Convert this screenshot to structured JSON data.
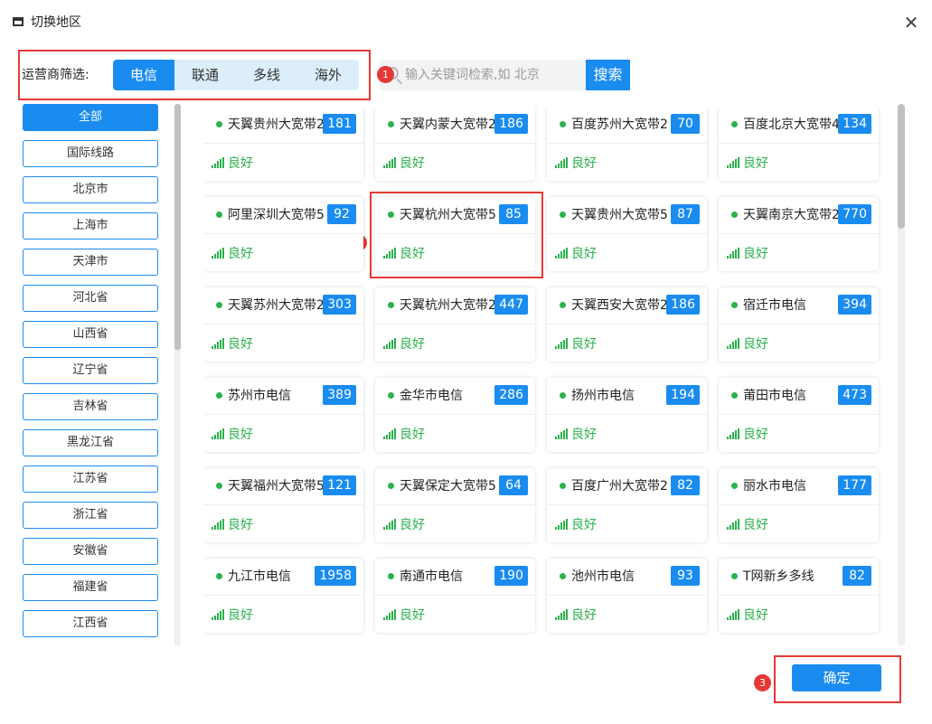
{
  "window": {
    "title": "切换地区",
    "close_symbol": "✕"
  },
  "filter": {
    "label": "运营商筛选:",
    "isps": [
      {
        "label": "电信",
        "active": true
      },
      {
        "label": "联通",
        "active": false
      },
      {
        "label": "多线",
        "active": false
      },
      {
        "label": "海外",
        "active": false
      }
    ]
  },
  "search": {
    "placeholder": "输入关键词检索,如 北京",
    "button_label": "搜索"
  },
  "annotations": {
    "badge1": "1",
    "badge2": "2",
    "badge3": "3",
    "color": "#e53935"
  },
  "sidebar": {
    "items": [
      {
        "label": "全部",
        "active": true
      },
      {
        "label": "国际线路",
        "active": false
      },
      {
        "label": "北京市",
        "active": false
      },
      {
        "label": "上海市",
        "active": false
      },
      {
        "label": "天津市",
        "active": false
      },
      {
        "label": "河北省",
        "active": false
      },
      {
        "label": "山西省",
        "active": false
      },
      {
        "label": "辽宁省",
        "active": false
      },
      {
        "label": "吉林省",
        "active": false
      },
      {
        "label": "黑龙江省",
        "active": false
      },
      {
        "label": "江苏省",
        "active": false
      },
      {
        "label": "浙江省",
        "active": false
      },
      {
        "label": "安徽省",
        "active": false
      },
      {
        "label": "福建省",
        "active": false
      },
      {
        "label": "江西省",
        "active": false
      }
    ]
  },
  "regions": [
    {
      "name": "天翼贵州大宽带2",
      "count": "181",
      "status": "良好"
    },
    {
      "name": "天翼内蒙大宽带2",
      "count": "186",
      "status": "良好"
    },
    {
      "name": "百度苏州大宽带2",
      "count": "70",
      "status": "良好"
    },
    {
      "name": "百度北京大宽带4",
      "count": "134",
      "status": "良好"
    },
    {
      "name": "阿里深圳大宽带5",
      "count": "92",
      "status": "良好"
    },
    {
      "name": "天翼杭州大宽带5",
      "count": "85",
      "status": "良好",
      "selected": true
    },
    {
      "name": "天翼贵州大宽带5",
      "count": "87",
      "status": "良好"
    },
    {
      "name": "天翼南京大宽带2",
      "count": "770",
      "status": "良好"
    },
    {
      "name": "天翼苏州大宽带2",
      "count": "303",
      "status": "良好"
    },
    {
      "name": "天翼杭州大宽带2",
      "count": "447",
      "status": "良好"
    },
    {
      "name": "天翼西安大宽带2",
      "count": "186",
      "status": "良好"
    },
    {
      "name": "宿迁市电信",
      "count": "394",
      "status": "良好"
    },
    {
      "name": "苏州市电信",
      "count": "389",
      "status": "良好"
    },
    {
      "name": "金华市电信",
      "count": "286",
      "status": "良好"
    },
    {
      "name": "扬州市电信",
      "count": "194",
      "status": "良好"
    },
    {
      "name": "莆田市电信",
      "count": "473",
      "status": "良好"
    },
    {
      "name": "天翼福州大宽带5",
      "count": "121",
      "status": "良好"
    },
    {
      "name": "天翼保定大宽带5",
      "count": "64",
      "status": "良好"
    },
    {
      "name": "百度广州大宽带2",
      "count": "82",
      "status": "良好"
    },
    {
      "name": "丽水市电信",
      "count": "177",
      "status": "良好"
    },
    {
      "name": "九江市电信",
      "count": "1958",
      "status": "良好"
    },
    {
      "name": "南通市电信",
      "count": "190",
      "status": "良好"
    },
    {
      "name": "池州市电信",
      "count": "93",
      "status": "良好"
    },
    {
      "name": "T网新乡多线",
      "count": "82",
      "status": "良好"
    }
  ],
  "footer": {
    "confirm_label": "确定"
  },
  "colors": {
    "accent": "#1a8cf0",
    "good": "#2bb24c",
    "highlight": "#e53935"
  },
  "icons": {
    "window": "window-icon",
    "close": "close-icon",
    "search": "search-icon",
    "signal": "signal-icon",
    "dot": "status-dot-icon"
  }
}
